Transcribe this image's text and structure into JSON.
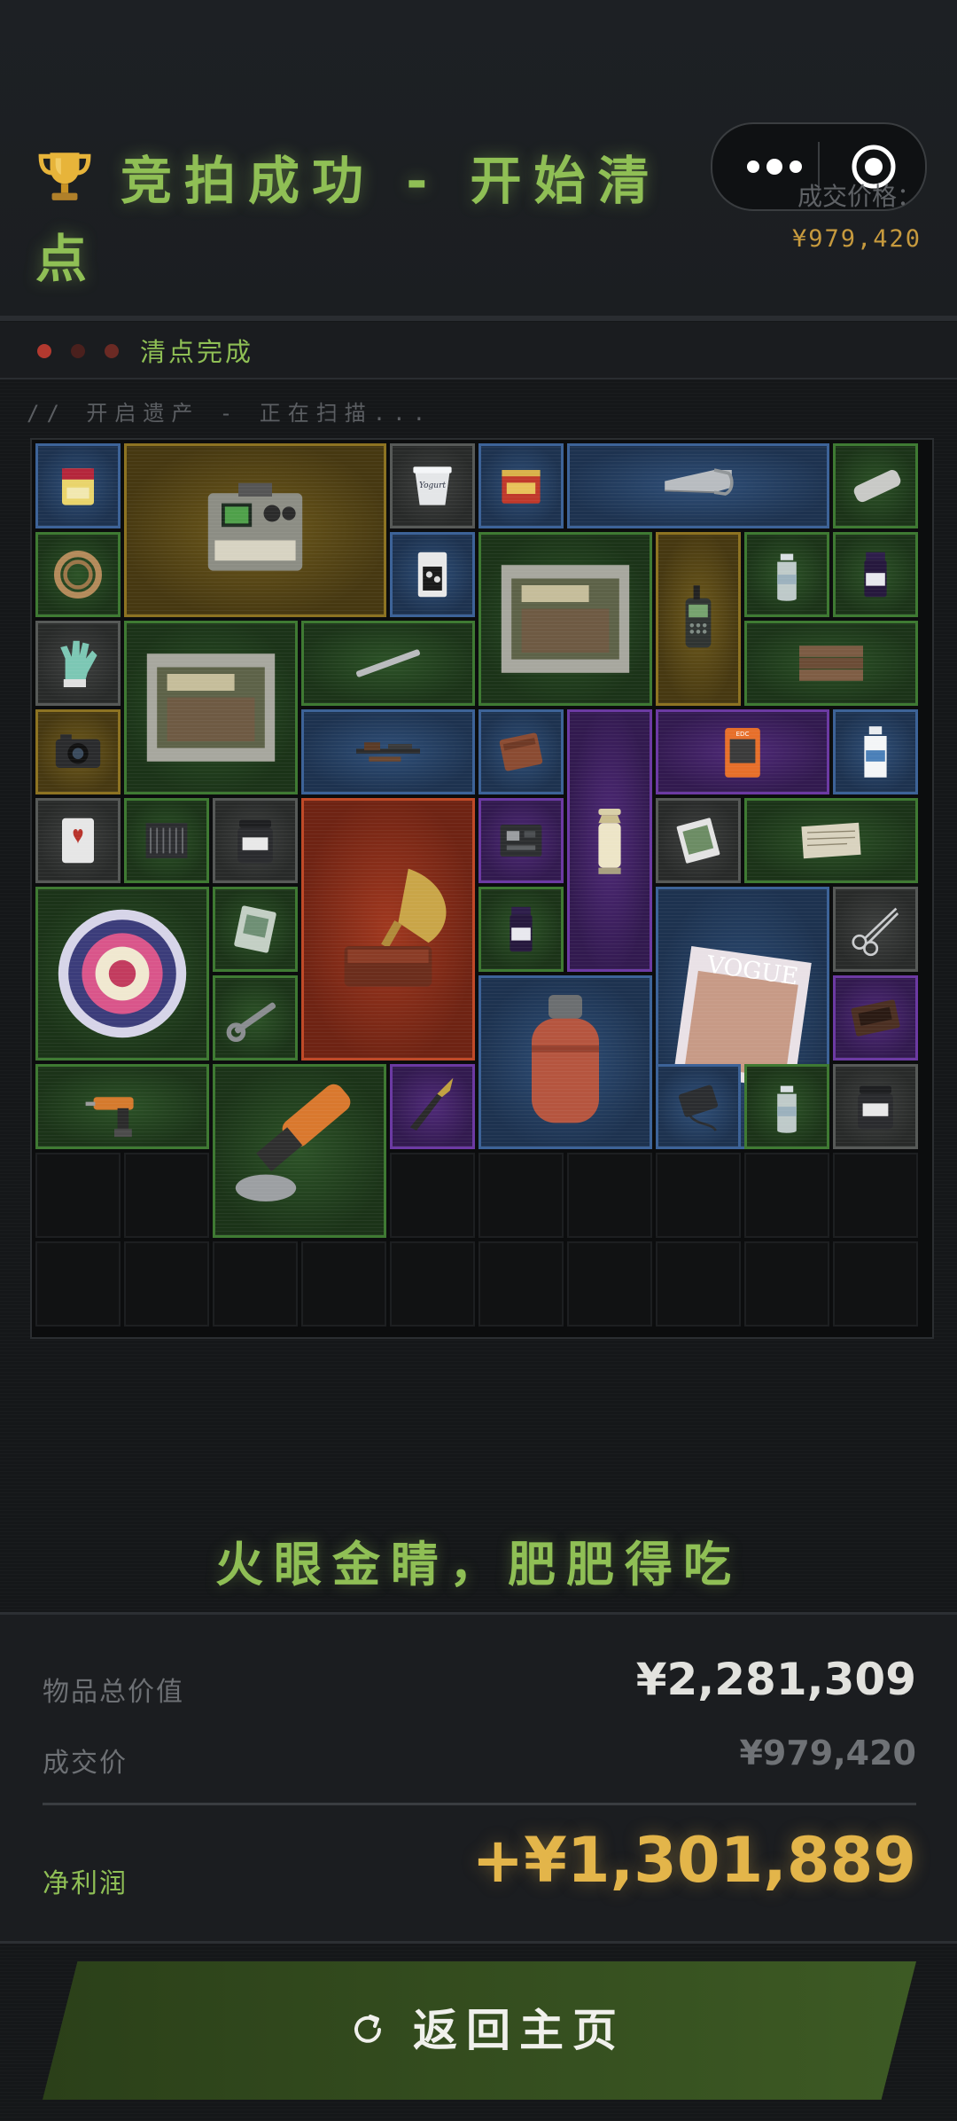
{
  "header": {
    "title": "竞拍成功 - 开始清点",
    "price_label": "成交价格：",
    "price_value": "¥979,420"
  },
  "status": {
    "text": "清点完成",
    "dot_colors": [
      "#b2392f",
      "#5a2420",
      "#6b2a24"
    ]
  },
  "scan_text": "// 开启遗产 - 正在扫描...",
  "slogan": "火眼金睛，肥肥得吃",
  "summary": {
    "total_label": "物品总价值",
    "total_value": "¥2,281,309",
    "deal_label": "成交价",
    "deal_value": "¥979,420",
    "profit_label": "净利润",
    "profit_value": "+¥1,301,889"
  },
  "back_button": {
    "label": "返回主页",
    "icon": "refresh-icon"
  },
  "colors": {
    "accent_green": "#8fbf55",
    "gold": "#e3b54a",
    "rarity_blue": "#3d6398",
    "rarity_green": "#3f7a33",
    "rarity_gold": "#8d7322",
    "rarity_purple": "#6c3aa3",
    "rarity_red": "#c04a28",
    "rarity_gray": "#575a58"
  },
  "inventory": {
    "columns": 10,
    "rows": 10,
    "items": [
      {
        "name": "sd-card",
        "rarity": "blue",
        "col": 0,
        "row": 0,
        "w": 1,
        "h": 1
      },
      {
        "name": "military-radio-station",
        "rarity": "gold",
        "col": 1,
        "row": 0,
        "w": 3,
        "h": 2
      },
      {
        "name": "yogurt-tub",
        "rarity": "gray",
        "col": 4,
        "row": 0,
        "w": 1,
        "h": 1
      },
      {
        "name": "tea-tin",
        "rarity": "blue",
        "col": 5,
        "row": 0,
        "w": 1,
        "h": 1
      },
      {
        "name": "hand-saw",
        "rarity": "blue",
        "col": 6,
        "row": 0,
        "w": 3,
        "h": 1
      },
      {
        "name": "tube",
        "rarity": "green",
        "col": 9,
        "row": 0,
        "w": 1,
        "h": 1
      },
      {
        "name": "rope-coil",
        "rarity": "green",
        "col": 0,
        "row": 1,
        "w": 1,
        "h": 1
      },
      {
        "name": "earbuds-box",
        "rarity": "blue",
        "col": 4,
        "row": 1,
        "w": 1,
        "h": 1
      },
      {
        "name": "building-model-box",
        "rarity": "green",
        "col": 5,
        "row": 1,
        "w": 2,
        "h": 2
      },
      {
        "name": "walkie-talkie",
        "rarity": "gold",
        "col": 7,
        "row": 1,
        "w": 1,
        "h": 2
      },
      {
        "name": "water-bottle",
        "rarity": "green",
        "col": 8,
        "row": 1,
        "w": 1,
        "h": 1
      },
      {
        "name": "medicine-vial",
        "rarity": "green",
        "col": 9,
        "row": 1,
        "w": 1,
        "h": 1
      },
      {
        "name": "work-glove",
        "rarity": "gray",
        "col": 0,
        "row": 2,
        "w": 1,
        "h": 1
      },
      {
        "name": "building-model-box",
        "rarity": "green",
        "col": 1,
        "row": 2,
        "w": 2,
        "h": 2
      },
      {
        "name": "metal-rod",
        "rarity": "green",
        "col": 3,
        "row": 2,
        "w": 2,
        "h": 1
      },
      {
        "name": "wood-planks",
        "rarity": "green",
        "col": 8,
        "row": 2,
        "w": 2,
        "h": 1
      },
      {
        "name": "camera",
        "rarity": "gold",
        "col": 0,
        "row": 3,
        "w": 1,
        "h": 1
      },
      {
        "name": "rifle-parts",
        "rarity": "blue",
        "col": 3,
        "row": 3,
        "w": 2,
        "h": 1
      },
      {
        "name": "leather-wallet",
        "rarity": "blue",
        "col": 5,
        "row": 3,
        "w": 1,
        "h": 1
      },
      {
        "name": "lantern",
        "rarity": "purple",
        "col": 6,
        "row": 3,
        "w": 1,
        "h": 3
      },
      {
        "name": "edc-kit",
        "rarity": "purple",
        "col": 7,
        "row": 3,
        "w": 2,
        "h": 1
      },
      {
        "name": "plastic-bottle",
        "rarity": "blue",
        "col": 9,
        "row": 3,
        "w": 1,
        "h": 1
      },
      {
        "name": "playing-card",
        "rarity": "gray",
        "col": 0,
        "row": 4,
        "w": 1,
        "h": 1
      },
      {
        "name": "cpu-cooler",
        "rarity": "green",
        "col": 1,
        "row": 4,
        "w": 1,
        "h": 1
      },
      {
        "name": "supplement-jar",
        "rarity": "gray",
        "col": 2,
        "row": 4,
        "w": 1,
        "h": 1
      },
      {
        "name": "gramophone",
        "rarity": "red",
        "col": 3,
        "row": 4,
        "w": 2,
        "h": 3
      },
      {
        "name": "circuit-board",
        "rarity": "purple",
        "col": 5,
        "row": 4,
        "w": 1,
        "h": 1
      },
      {
        "name": "matchbox",
        "rarity": "gray",
        "col": 7,
        "row": 4,
        "w": 1,
        "h": 1
      },
      {
        "name": "paper-documents",
        "rarity": "green",
        "col": 8,
        "row": 4,
        "w": 2,
        "h": 1
      },
      {
        "name": "decorative-plate",
        "rarity": "green",
        "col": 0,
        "row": 5,
        "w": 2,
        "h": 2
      },
      {
        "name": "tablet-package",
        "rarity": "green",
        "col": 2,
        "row": 5,
        "w": 1,
        "h": 1
      },
      {
        "name": "medicine-vial",
        "rarity": "green",
        "col": 5,
        "row": 5,
        "w": 1,
        "h": 1
      },
      {
        "name": "magazine",
        "rarity": "blue",
        "col": 7,
        "row": 5,
        "w": 2,
        "h": 3
      },
      {
        "name": "scissors",
        "rarity": "gray",
        "col": 9,
        "row": 5,
        "w": 1,
        "h": 1
      },
      {
        "name": "wrench",
        "rarity": "green",
        "col": 2,
        "row": 6,
        "w": 1,
        "h": 1
      },
      {
        "name": "gas-cylinder",
        "rarity": "blue",
        "col": 5,
        "row": 6,
        "w": 2,
        "h": 2
      },
      {
        "name": "cassette-tape",
        "rarity": "purple",
        "col": 9,
        "row": 6,
        "w": 1,
        "h": 1
      },
      {
        "name": "power-drill",
        "rarity": "green",
        "col": 0,
        "row": 7,
        "w": 2,
        "h": 1
      },
      {
        "name": "angle-grinder",
        "rarity": "green",
        "col": 2,
        "row": 7,
        "w": 2,
        "h": 2
      },
      {
        "name": "combat-knife",
        "rarity": "purple",
        "col": 4,
        "row": 7,
        "w": 1,
        "h": 1
      },
      {
        "name": "power-adapter",
        "rarity": "blue",
        "col": 7,
        "row": 7,
        "w": 1,
        "h": 1
      },
      {
        "name": "water-bottle",
        "rarity": "green",
        "col": 8,
        "row": 7,
        "w": 1,
        "h": 1
      },
      {
        "name": "supplement-jar",
        "rarity": "gray",
        "col": 9,
        "row": 7,
        "w": 1,
        "h": 1
      }
    ]
  }
}
